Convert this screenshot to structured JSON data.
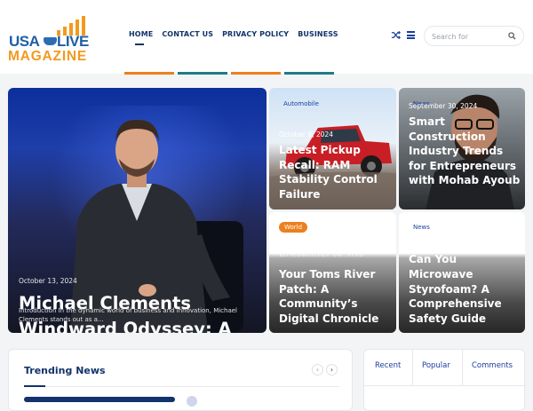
{
  "logo": {
    "line1_left": "USA",
    "line1_right": "LIVE",
    "line2": "MAGAZINE"
  },
  "nav": {
    "items": [
      "HOME",
      "CONTACT US",
      "PRIVACY POLICY",
      "BUSINESS"
    ],
    "active": "HOME"
  },
  "header_icons": {
    "shuffle": "shuffle-icon",
    "menu": "menu-icon"
  },
  "search": {
    "placeholder": "Search for",
    "icon": "search-icon"
  },
  "colors": {
    "navy": "#12336b",
    "accent_blue": "#1a3fa0",
    "orange": "#ec7f1e",
    "teal": "#1d7c83",
    "stripe_dark": "#2c3e50"
  },
  "hero": {
    "date": "October 13, 2024",
    "title": "Michael Clements Windward Odyssey: A Saga of Growth and Excellence",
    "excerpt": "Introduction In the dynamic world of business and innovation, Michael Clements stands out as a..."
  },
  "cards": [
    {
      "category": "Automobile",
      "date": "October 8, 2024",
      "title": "Latest Pickup Recall: RAM Stability Control Failure"
    },
    {
      "category": "News",
      "date": "September 30, 2024",
      "title": "Smart Construction Industry Trends for Entrepreneurs with Mohab Ayoub"
    },
    {
      "category": "World",
      "date": "",
      "title": "Your Toms River Patch: A Community’s Digital Chronicle",
      "partial_top_line": "Bresonnel to Tris"
    },
    {
      "category": "News",
      "date": "",
      "title": "Microwave Styrofoam? A Comprehensive Safety Guide",
      "partial_top_line": "Can You"
    }
  ],
  "trending": {
    "title": "Trending News",
    "prev": "‹",
    "next": "›"
  },
  "tabs": [
    "Recent",
    "Popular",
    "Comments"
  ]
}
